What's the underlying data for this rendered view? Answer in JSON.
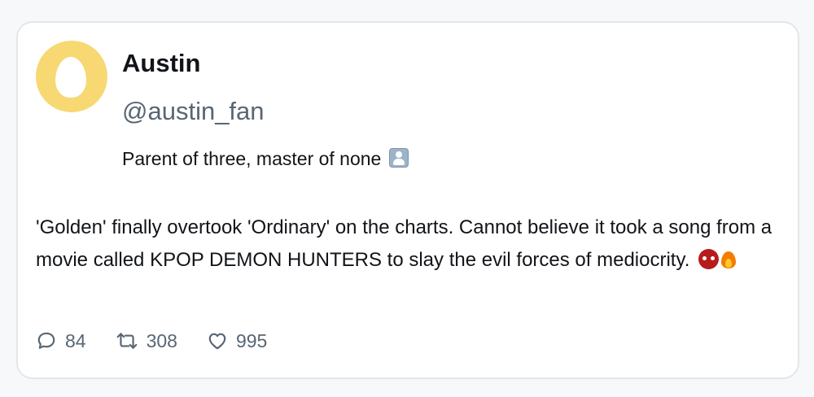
{
  "user": {
    "name": "Austin",
    "handle": "@austin_fan",
    "bio": "Parent of three, master of none",
    "avatar_color": "#f7d872"
  },
  "post": {
    "text": "'Golden' finally overtook 'Ordinary' on the charts. Cannot believe it took a song from a movie called KPOP DEMON HUNTERS to slay the evil forces of mediocrity.",
    "emojis": [
      "ogre-emoji",
      "fire-emoji"
    ]
  },
  "stats": {
    "replies": "84",
    "reposts": "308",
    "likes": "995"
  },
  "icons": {
    "reply": "speech-bubble-icon",
    "repost": "repost-arrows-icon",
    "like": "heart-icon"
  },
  "colors": {
    "text": "#111418",
    "muted": "#586673",
    "border": "#e3e6ea"
  }
}
